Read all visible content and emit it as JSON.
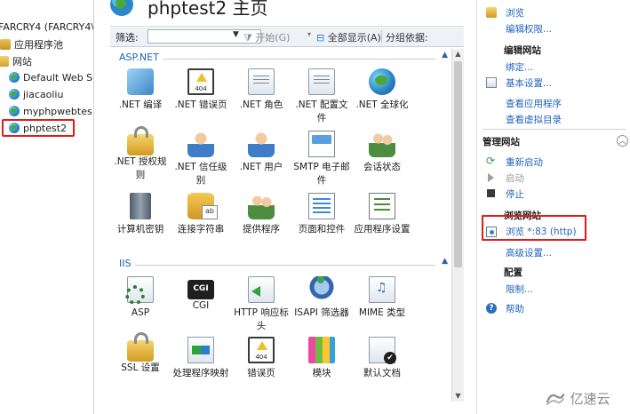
{
  "tree": {
    "items": [
      {
        "label": "FARCRY4 (FARCRY4\\",
        "icon": "server-icon",
        "selected": false
      },
      {
        "label": "应用程序池",
        "icon": "app-pool-icon",
        "selected": false
      },
      {
        "label": "网站",
        "icon": "sites-folder-icon",
        "selected": false
      },
      {
        "label": "Default Web S",
        "icon": "globe-icon",
        "selected": false
      },
      {
        "label": "jiacaoliu",
        "icon": "globe-icon",
        "selected": false
      },
      {
        "label": "myphpwebtes",
        "icon": "globe-icon",
        "selected": false
      },
      {
        "label": "phptest2",
        "icon": "globe-icon",
        "selected": true
      }
    ]
  },
  "header": {
    "title": "phptest2 主页",
    "icon": "globe-icon"
  },
  "filterbar": {
    "label": "筛选:",
    "start": "开始(G)",
    "show_all": "全部显示(A)",
    "group_by": "分组依据:"
  },
  "sections": [
    {
      "name": "ASP.NET",
      "tiles": [
        {
          "label": ".NET 编译",
          "icon": "net-compile-icon"
        },
        {
          "label": ".NET 错误页",
          "icon": "net-error-pages-icon"
        },
        {
          "label": ".NET 角色",
          "icon": "net-roles-icon"
        },
        {
          "label": ".NET 配置文件",
          "icon": "net-profile-icon"
        },
        {
          "label": ".NET 全球化",
          "icon": "net-globalization-icon"
        },
        {
          "label": ".NET 授权规则",
          "icon": "net-authorization-icon"
        },
        {
          "label": ".NET 信任级别",
          "icon": "net-trust-levels-icon"
        },
        {
          "label": ".NET 用户",
          "icon": "net-users-icon"
        },
        {
          "label": "SMTP 电子邮件",
          "icon": "smtp-email-icon"
        },
        {
          "label": "会话状态",
          "icon": "session-state-icon"
        },
        {
          "label": "计算机密钥",
          "icon": "machine-key-icon"
        },
        {
          "label": "连接字符串",
          "icon": "connection-strings-icon"
        },
        {
          "label": "提供程序",
          "icon": "providers-icon"
        },
        {
          "label": "页面和控件",
          "icon": "pages-controls-icon"
        },
        {
          "label": "应用程序设置",
          "icon": "app-settings-icon"
        }
      ]
    },
    {
      "name": "IIS",
      "tiles": [
        {
          "label": "ASP",
          "icon": "asp-icon"
        },
        {
          "label": "CGI",
          "icon": "cgi-icon"
        },
        {
          "label": "HTTP 响应标头",
          "icon": "http-response-headers-icon"
        },
        {
          "label": "ISAPI 筛选器",
          "icon": "isapi-filters-icon"
        },
        {
          "label": "MIME 类型",
          "icon": "mime-types-icon"
        },
        {
          "label": "SSL 设置",
          "icon": "ssl-settings-icon"
        },
        {
          "label": "处理程序映射",
          "icon": "handler-mappings-icon"
        },
        {
          "label": "错误页",
          "icon": "error-pages-icon"
        },
        {
          "label": "模块",
          "icon": "modules-icon"
        },
        {
          "label": "默认文档",
          "icon": "default-document-icon"
        }
      ]
    }
  ],
  "actions": {
    "explore": "浏览",
    "edit_permissions": "编辑权限...",
    "edit_site_head": "编辑网站",
    "bindings": "绑定...",
    "basic_settings": "基本设置...",
    "view_applications": "查看应用程序",
    "view_virtual_dirs": "查看虚拟目录",
    "manage_site_head": "管理网站",
    "restart": "重新启动",
    "start": "启动",
    "stop": "停止",
    "browse_site_head": "浏览网站",
    "browse_83": "浏览 *:83 (http)",
    "advanced_settings": "高级设置...",
    "config_head": "配置",
    "limits": "限制...",
    "help": "帮助"
  },
  "watermark": {
    "text": "亿速云"
  },
  "colors": {
    "link": "#2264bc",
    "section_header": "#2163b5",
    "highlight_box": "#e21b1b"
  }
}
